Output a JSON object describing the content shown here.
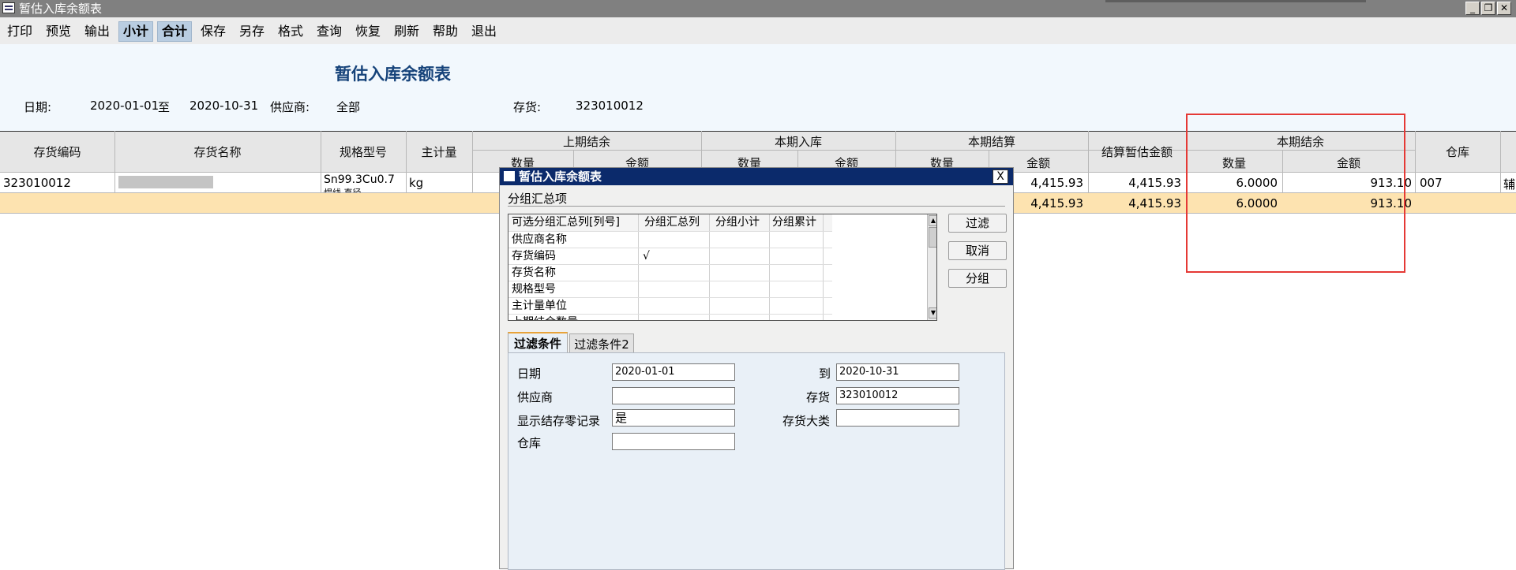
{
  "window": {
    "title": "暂估入库余额表"
  },
  "toolbar": [
    "打印",
    "预览",
    "输出",
    "小计",
    "合计",
    "保存",
    "另存",
    "格式",
    "查询",
    "恢复",
    "刷新",
    "帮助",
    "退出"
  ],
  "report": {
    "title": "暂估入库余额表",
    "date_label": "日期:",
    "date_from": "2020-01-01",
    "to_label": "至",
    "date_to": "2020-10-31",
    "supplier_label": "供应商:",
    "supplier_value": "全部",
    "stock_label": "存货:",
    "stock_value": "323010012"
  },
  "grid": {
    "col_code": "存货编码",
    "col_name": "存货名称",
    "col_spec": "规格型号",
    "col_unit": "主计量",
    "group_prev": "上期结余",
    "group_in": "本期入库",
    "group_settle": "本期结算",
    "col_settle_amount": "结算暂估金额",
    "group_end": "本期结余",
    "col_warehouse": "仓库",
    "sub_qty": "数量",
    "sub_amount": "金额",
    "row1": {
      "code": "323010012",
      "spec_line1": "Sn99.3Cu0.7",
      "spec_line2": "焊线 直径",
      "unit": "kg",
      "settle_amount": "4,415.93",
      "settle_est": "4,415.93",
      "end_qty": "6.0000",
      "end_amount": "913.10",
      "warehouse": "007",
      "extra": "辅"
    },
    "row2": {
      "settle_amount": "4,415.93",
      "settle_est": "4,415.93",
      "end_qty": "6.0000",
      "end_amount": "913.10"
    }
  },
  "dialog": {
    "title": "暂估入库余额表",
    "close": "X",
    "group_section": "分组汇总项",
    "group_headers": [
      "可选分组汇总列[列号]",
      "分组汇总列",
      "分组小计",
      "分组累计"
    ],
    "group_rows": [
      {
        "name": "供应商名称",
        "summary": ""
      },
      {
        "name": "存货编码",
        "summary": "√"
      },
      {
        "name": "存货名称",
        "summary": ""
      },
      {
        "name": "规格型号",
        "summary": ""
      },
      {
        "name": "主计量单位",
        "summary": ""
      },
      {
        "name": "上期结余数量",
        "summary": ""
      }
    ],
    "buttons": {
      "filter": "过滤",
      "cancel": "取消",
      "group": "分组"
    },
    "tabs": [
      "过滤条件",
      "过滤条件2"
    ],
    "fields": {
      "date_label": "日期",
      "date_value": "2020-01-01",
      "to_label": "到",
      "to_value": "2020-10-31",
      "supplier_label": "供应商",
      "supplier_value": "",
      "stock_label": "存货",
      "stock_value": "323010012",
      "zero_label": "显示结存零记录",
      "zero_value": "是",
      "category_label": "存货大类",
      "category_value": "",
      "warehouse_label": "仓库",
      "warehouse_value": ""
    }
  }
}
